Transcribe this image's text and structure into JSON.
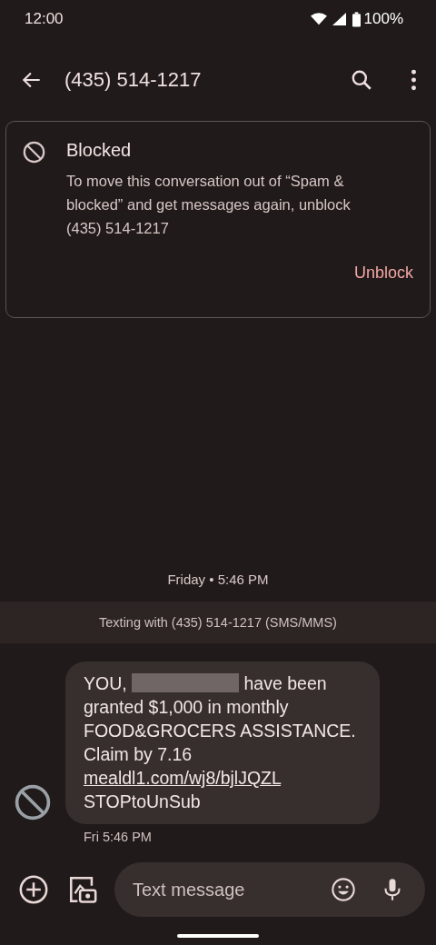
{
  "status_bar": {
    "time": "12:00",
    "battery": "100%"
  },
  "app_bar": {
    "title": "(435) 514-1217"
  },
  "blocked_card": {
    "title": "Blocked",
    "body": "To move this conversation out of “Spam & blocked” and get messages again, unblock (435) 514-1217",
    "action": "Unblock"
  },
  "date_divider": "Friday • 5:46 PM",
  "banner": "Texting with (435) 514-1217 (SMS/MMS)",
  "messages": [
    {
      "sender_blocked": true,
      "text_before": "YOU,",
      "redacted": true,
      "text_after": "have been granted $1,000 in  monthly FOOD&GROCERS ASSISTANCE. Claim by 7.16",
      "link": "mealdl1.com/wj8/bjlJQZL",
      "text_end": "STOPtoUnSub",
      "time": "Fri 5:46 PM"
    }
  ],
  "composer": {
    "placeholder": "Text message"
  }
}
